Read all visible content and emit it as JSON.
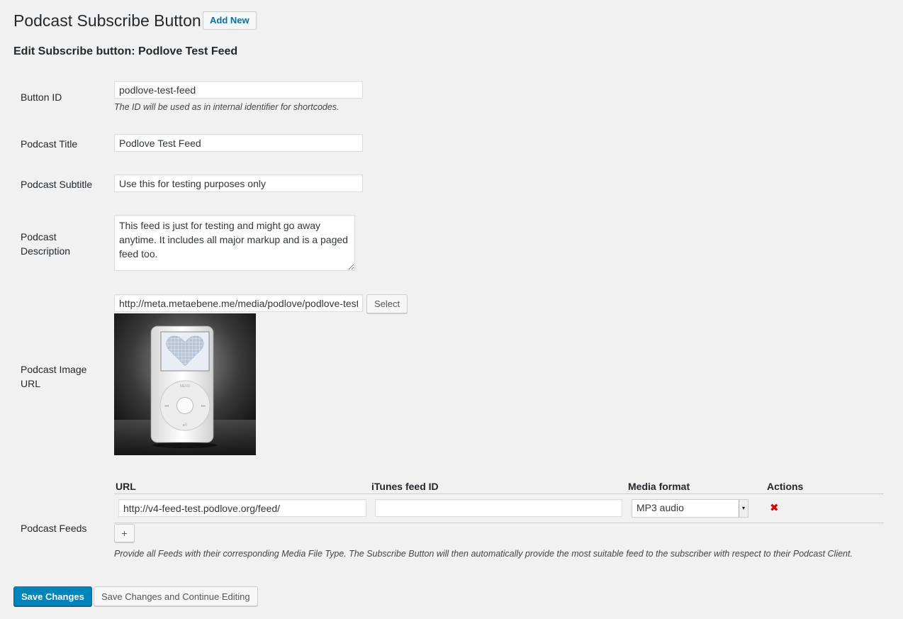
{
  "header": {
    "title": "Podcast Subscribe Button",
    "add_new": "Add New",
    "edit_heading": "Edit Subscribe button: Podlove Test Feed"
  },
  "form": {
    "button_id": {
      "label": "Button ID",
      "value": "podlove-test-feed",
      "description": "The ID will be used as in internal identifier for shortcodes."
    },
    "title": {
      "label": "Podcast Title",
      "value": "Podlove Test Feed"
    },
    "subtitle": {
      "label": "Podcast Subtitle",
      "value": "Use this for testing purposes only"
    },
    "description": {
      "label_line1": "Podcast",
      "label_line2": "Description",
      "value": "This feed is just for testing and might go away anytime. It includes all major markup and is a paged feed too."
    },
    "image": {
      "label_line1": "Podcast Image",
      "label_line2": "URL",
      "value": "http://meta.metaebene.me/media/podlove/podlove-test-feed.jpg",
      "select_label": "Select",
      "image_icon": "ipod-heart-image"
    },
    "feeds": {
      "label": "Podcast Feeds",
      "columns": [
        "URL",
        "iTunes feed ID",
        "Media format",
        "Actions"
      ],
      "rows": [
        {
          "url": "http://v4-feed-test.podlove.org/feed/",
          "itunes_id": "",
          "format": "MP3 audio",
          "action_icon": "remove-x-icon"
        }
      ],
      "add_label": "+",
      "help": "Provide all Feeds with their corresponding Media File Type. The Subscribe Button will then automatically provide the most suitable feed to the subscriber with respect to their Podcast Client."
    }
  },
  "actions": {
    "save": "Save Changes",
    "save_continue": "Save Changes and Continue Editing"
  },
  "colors": {
    "background": "#f1f1f1",
    "primary": "#0085ba",
    "link": "#0073aa",
    "danger": "#dd0000"
  }
}
